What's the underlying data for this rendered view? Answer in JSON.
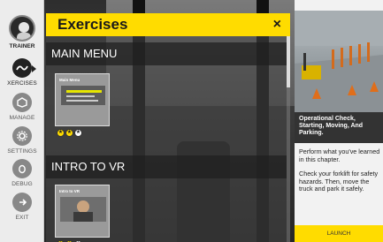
{
  "sidebar": {
    "trainer_label": "TRAINER",
    "items": [
      {
        "label": "XERCISES",
        "icon": "exercises-icon",
        "active": true
      },
      {
        "label": "MANAGE",
        "icon": "manage-icon"
      },
      {
        "label": "SETTINGS",
        "icon": "gear-icon"
      },
      {
        "label": "DEBUG",
        "icon": "debug-icon"
      },
      {
        "label": "EXIT",
        "icon": "exit-icon"
      }
    ]
  },
  "panel": {
    "title": "Exercises",
    "close_label": "×",
    "sections": [
      {
        "title": "MAIN MENU",
        "thumb_title": "Main Menu",
        "stars": [
          "★",
          "★",
          "★"
        ]
      },
      {
        "title": "INTRO TO VR",
        "thumb_title": "Intro to VR",
        "stars": [
          "★",
          "★",
          "★"
        ]
      }
    ]
  },
  "details": {
    "title": "Operational Check, Starting, Moving, And Parking.",
    "description1": "Perform what you've learned in this chapter.",
    "description2": "Check your forklift for safety hazards. Then, move the truck and park it safely.",
    "launch_label": "LAUNCH"
  },
  "colors": {
    "accent": "#ffdc00",
    "sidebar_bg": "#ececec",
    "dark_bar": "#333333"
  }
}
